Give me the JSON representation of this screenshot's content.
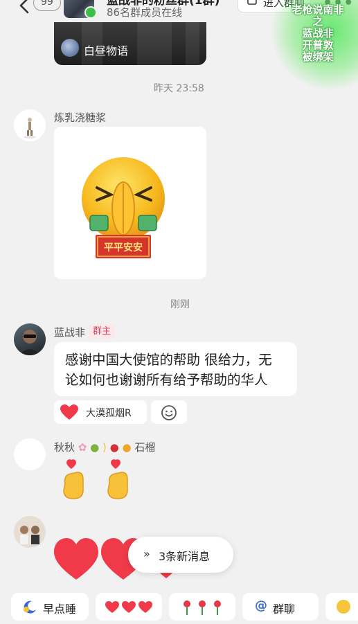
{
  "header": {
    "back_count": "99",
    "group_title": "蓝战非的粉丝群(1群)",
    "member_status": "86名群成员在线",
    "enter_label": "进入群聊"
  },
  "watermark": {
    "lines": [
      "老枪说南非",
      "之",
      "蓝战非",
      "开普敦",
      "被绑架"
    ]
  },
  "messages": {
    "video_card": {
      "source": "白昼物语"
    },
    "time_1": "昨天 23:58",
    "msg1": {
      "sender": "炼乳浇糖浆",
      "sticker_caption": "平平安安"
    },
    "time_2": "刚刚",
    "msg2": {
      "sender": "蓝战非",
      "role_tag": "群主",
      "line1": "感谢中国大使馆的帮助 很给力，无",
      "line2": "论如何也谢谢所有给予帮助的华人",
      "reaction_user": "大漠孤烟R"
    },
    "msg3": {
      "sender_name": "秋秋",
      "sender_suffix": "石榴"
    },
    "msg4": {
      "sender": ""
    }
  },
  "new_messages": {
    "label": "3条新消息"
  },
  "quick_replies": {
    "early_sleep": "早点睡",
    "group_chat": "群聊"
  },
  "colors": {
    "background": "#f1f1f1",
    "owner_tag_text": "#d9455f",
    "owner_tag_bg": "#fde8ea",
    "online_green": "#3bbf4a",
    "heart_red": "#f03a4a"
  }
}
